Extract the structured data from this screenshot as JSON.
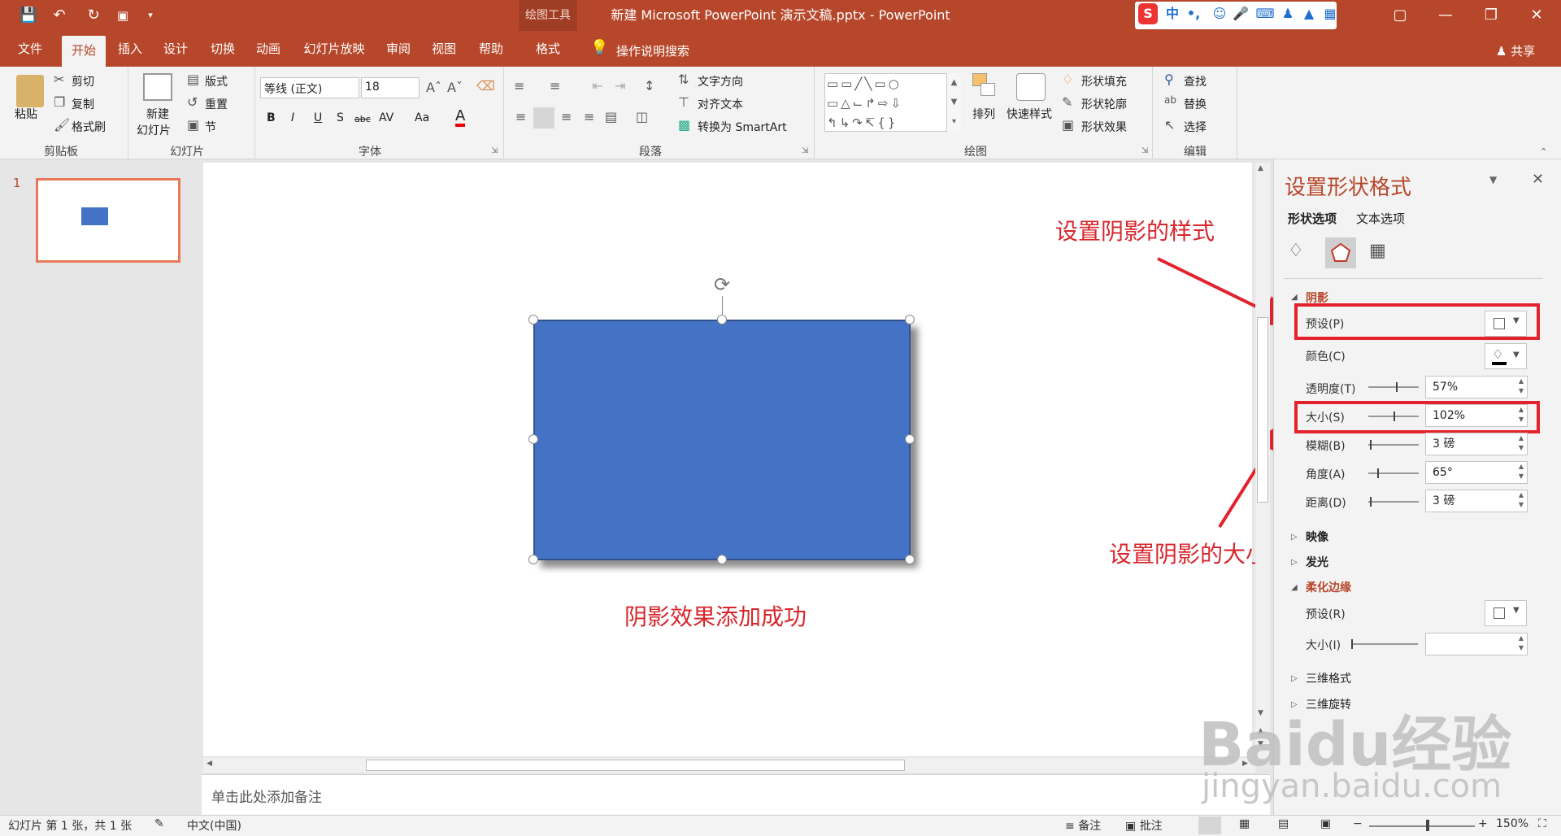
{
  "window": {
    "title": "新建 Microsoft PowerPoint 演示文稿.pptx  -  PowerPoint",
    "context_tab": "绘图工具",
    "quick_access": [
      "save-icon",
      "undo-icon",
      "redo-icon",
      "slideshow-from-start-icon",
      "customize-icon"
    ],
    "ime_indicator": "中"
  },
  "tabs": [
    "文件",
    "开始",
    "插入",
    "设计",
    "切换",
    "动画",
    "幻灯片放映",
    "审阅",
    "视图",
    "帮助",
    "格式"
  ],
  "active_tab": "开始",
  "search_label": "操作说明搜索",
  "share_label": "共享",
  "ribbon": {
    "clipboard": {
      "label": "剪贴板",
      "paste": "粘贴",
      "cut": "剪切",
      "copy": "复制",
      "format_painter": "格式刷"
    },
    "slides": {
      "label": "幻灯片",
      "new_slide_1": "新建",
      "new_slide_2": "幻灯片",
      "layout": "版式",
      "reset": "重置",
      "section": "节"
    },
    "font": {
      "label": "字体",
      "font_name": "等线 (正文)",
      "font_size": "18",
      "bold": "B",
      "italic": "I",
      "underline": "U",
      "shadow": "S",
      "strike": "abc",
      "spacing": "AV",
      "case": "Aa",
      "color": "A"
    },
    "paragraph": {
      "label": "段落",
      "text_direction": "文字方向",
      "align_text": "对齐文本",
      "convert_smartart": "转换为 SmartArt"
    },
    "drawing": {
      "label": "绘图",
      "arrange": "排列",
      "quick_styles": "快速样式",
      "shape_fill": "形状填充",
      "shape_outline": "形状轮廓",
      "shape_effects": "形状效果"
    },
    "editing": {
      "label": "编辑",
      "find": "查找",
      "replace": "替换",
      "select": "选择"
    }
  },
  "slide_panel": {
    "slide_number": "1"
  },
  "annotations": {
    "caption": "阴影效果添加成功",
    "shadow_style": "设置阴影的样式",
    "shadow_size": "设置阴影的大小"
  },
  "notes_placeholder": "单击此处添加备注",
  "format_pane": {
    "title": "设置形状格式",
    "tab_shape": "形状选项",
    "tab_text": "文本选项",
    "shadow_section": "阴影",
    "preset_label": "预设(P)",
    "color_label": "颜色(C)",
    "transparency_label": "透明度(T)",
    "transparency_value": "57%",
    "size_label": "大小(S)",
    "size_value": "102%",
    "blur_label": "模糊(B)",
    "blur_value": "3 磅",
    "angle_label": "角度(A)",
    "angle_value": "65°",
    "distance_label": "距离(D)",
    "distance_value": "3 磅",
    "reflection_section": "映像",
    "glow_section": "发光",
    "soft_edges_section": "柔化边缘",
    "soft_preset_label": "预设(R)",
    "soft_size_label": "大小(I)",
    "three_d_format": "三维格式",
    "three_d_rotation": "三维旋转",
    "slider_levels": {
      "transparency": 0.57,
      "size": 0.51,
      "blur": 0.03,
      "angle": 0.18,
      "distance": 0.03
    }
  },
  "statusbar": {
    "slide_info": "幻灯片 第 1 张，共 1 张",
    "language": "中文(中国)",
    "notes": "备注",
    "comments": "批注",
    "zoom": "150%"
  },
  "watermark": {
    "brand": "Baidu经验",
    "url": "jingyan.baidu.com"
  },
  "colors": {
    "accent": "#b7472a",
    "shape_fill": "#4472c4",
    "annotation_red": "#e2232e"
  }
}
